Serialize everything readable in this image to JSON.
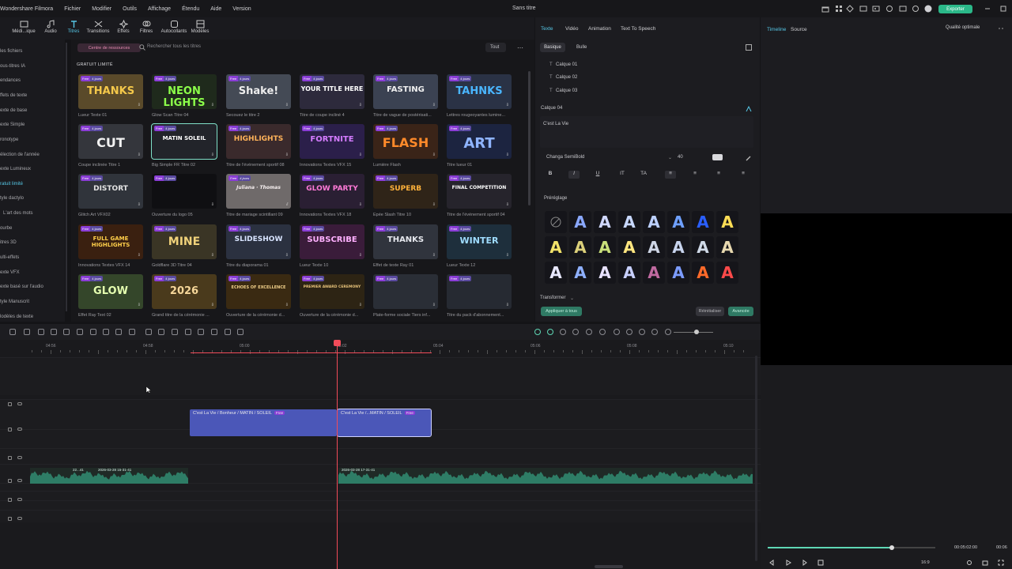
{
  "app": {
    "name": "Wondershare Filmora",
    "title": "Sans titre",
    "export": "Exporter"
  },
  "menu": [
    "Fichier",
    "Modifier",
    "Outils",
    "Affichage",
    "Étendu",
    "Aide",
    "Version"
  ],
  "tools": [
    {
      "label": "Médi...ique",
      "icon": "media-icon"
    },
    {
      "label": "Audio",
      "icon": "audio-icon"
    },
    {
      "label": "Titres",
      "icon": "titles-icon"
    },
    {
      "label": "Transitions",
      "icon": "transitions-icon"
    },
    {
      "label": "Effets",
      "icon": "effects-icon"
    },
    {
      "label": "Filtres",
      "icon": "filters-icon"
    },
    {
      "label": "Autocollants",
      "icon": "stickers-icon"
    },
    {
      "label": "Modèles",
      "icon": "templates-icon"
    }
  ],
  "sidebar": [
    "les fichiers",
    "ous-titres IA",
    "endances",
    "ffets de texte",
    "exte de base",
    "exte Simple",
    "ronotype",
    "élection de l'année",
    "exte Lumineux",
    "ratuit limité",
    "tyle dactylo",
    "L'art des mots",
    "ourbe",
    "itres 3D",
    "ulti-effets",
    "exte VFX",
    "exte basé sur l'audio",
    "tyle Manuscrit",
    "lodèles de texte"
  ],
  "library": {
    "resources": "Centre de ressources",
    "search": "Rechercher tous les titres",
    "filter": "Tout",
    "section": "GRATUIT LIMITÉ",
    "badge_free": "Free",
    "badge_days": "4 jours",
    "tiles": [
      {
        "text": "THANKS",
        "label": "Lueur Texte 01"
      },
      {
        "text": "NEON LIGHTS",
        "label": "Glow Scan Titre 04"
      },
      {
        "text": "Shake!",
        "label": "Secouez le titre 2"
      },
      {
        "text": "YOUR TITLE HERE",
        "label": "Titre de coupe incliné 4"
      },
      {
        "text": "FASTING",
        "label": "Titre de vague de postérisati..."
      },
      {
        "text": "TAHNKS",
        "label": "Lettres rougeoyantes lumine..."
      },
      {
        "text": "CUT",
        "label": "Coupe inclinée Titre 1"
      },
      {
        "text": "MATIN SOLEIL",
        "label": "Big Simple FR Titre 02"
      },
      {
        "text": "HIGHLIGHTS",
        "label": "Titre de l'événement sportif 08"
      },
      {
        "text": "FORTNITE",
        "label": "Innovations Textes VFX 15"
      },
      {
        "text": "FLASH",
        "label": "Lumière Flash"
      },
      {
        "text": "ART",
        "label": "Titre lueur 01"
      },
      {
        "text": "DISTORT",
        "label": "Glitch Art VFX02"
      },
      {
        "text": "",
        "label": "Ouverture du logo 05"
      },
      {
        "text": "Juliana · Thomas",
        "label": "Titre de mariage scintillant 09"
      },
      {
        "text": "GLOW PARTY",
        "label": "Innovations Textes VFX 18"
      },
      {
        "text": "SUPERB",
        "label": "Épée Slash Titre 10"
      },
      {
        "text": "FINAL COMPETITION",
        "label": "Titre de l'événement sportif 04"
      },
      {
        "text": "FULL GAME HIGHLIGHTS",
        "label": "Innovations Textes VFX 14"
      },
      {
        "text": "MINE",
        "label": "Goldflare 3D Titre 04"
      },
      {
        "text": "SLIDESHOW",
        "label": "Titre du diaporama 01"
      },
      {
        "text": "SUBSCRIBE",
        "label": "Lueur Texte 10"
      },
      {
        "text": "THANKS",
        "label": "Effet de texte Ray 01"
      },
      {
        "text": "WINTER",
        "label": "Lueur Texte 12"
      },
      {
        "text": "GLOW",
        "label": "Effet Ray Text 02"
      },
      {
        "text": "2026",
        "label": "Grand titre de la cérémonie ..."
      },
      {
        "text": "ECHOES OF EXCELLENCE",
        "label": "Ouverture de la cérémonie d..."
      },
      {
        "text": "PREMIER AWARD CEREMONY",
        "label": "Ouverture de la cérémonie d..."
      },
      {
        "text": "",
        "label": "Plate-forme sociale Tiers inf..."
      },
      {
        "text": "",
        "label": "Titre du pack d'abonnement..."
      }
    ]
  },
  "props": {
    "tabs": [
      "Texte",
      "Vidéo",
      "Animation",
      "Text To Speech"
    ],
    "subtabs": [
      "Basique",
      "Bulle"
    ],
    "layers": [
      "Calque 01",
      "Calque 02",
      "Calque 03"
    ],
    "layer_active": "Calque 04",
    "text_value": "C'est La Vie",
    "font": "Changa SemiBold",
    "size": "40",
    "format": [
      "B",
      "I",
      "U",
      "IT",
      "TA",
      "≡",
      "≡",
      "≡",
      "≡"
    ],
    "preset_label": "Préréglage",
    "preset_glyph": "A",
    "transform": "Transformer",
    "apply_all": "Appliquer à tous",
    "reset": "Réinitialiser",
    "advanced": "Avancée"
  },
  "preview": {
    "tabs": [
      "Timeline",
      "Source"
    ],
    "quality": "Qualité optimale",
    "time": "00:05:02:00",
    "total": "00:06",
    "ratio": "16:9",
    "progress": 0.74
  },
  "timeline": {
    "ticks": [
      "04:56",
      "04:58",
      "05:00",
      "05:02",
      "05:04",
      "05:06",
      "05:08",
      "05:10"
    ],
    "clips": [
      "C'est La Vie / Bonheur / MATIN / SOLEIL",
      "C'est La Vie /...MATIN / SOLEIL"
    ],
    "clip_badge": "Free",
    "audio_labels": [
      "22...41",
      "2026-03-28 15-31-41",
      "2026-03-28 17-31-41"
    ]
  },
  "colors": {
    "accent": "#56c7e6",
    "export": "#2bb889",
    "playhead": "#f24b59",
    "clip": "#4b57b8",
    "audio": "#2e7d66"
  }
}
